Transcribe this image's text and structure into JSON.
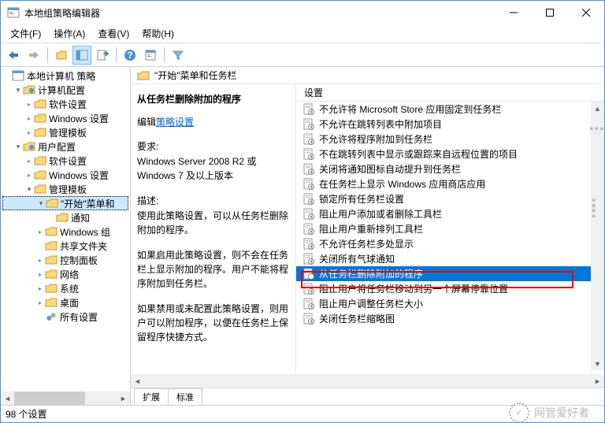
{
  "window": {
    "title": "本地组策略编辑器"
  },
  "menu": {
    "file": "文件(F)",
    "action": "操作(A)",
    "view": "查看(V)",
    "help": "帮助(H)"
  },
  "tree": {
    "root": "本地计算机 策略",
    "comp_conf": "计算机配置",
    "sw_settings1": "软件设置",
    "win_settings1": "Windows 设置",
    "admin_tpl1": "管理模板",
    "user_conf": "用户配置",
    "sw_settings2": "软件设置",
    "win_settings2": "Windows 设置",
    "admin_tpl2": "管理模板",
    "start_taskbar": "\"开始\"菜单和",
    "notify": "通知",
    "win_components": "Windows 组",
    "shared_folders": "共享文件夹",
    "control_panel": "控制面板",
    "network": "网络",
    "system": "系统",
    "desktop": "桌面",
    "all_settings": "所有设置"
  },
  "header": {
    "title": "\"开始\"菜单和任务栏"
  },
  "detail": {
    "title": "从任务栏删除附加的程序",
    "edit_prefix": "编辑",
    "edit_link": "策略设置",
    "req_label": "要求:",
    "req_text": "Windows Server 2008 R2 或 Windows 7 及以上版本",
    "desc_label": "描述:",
    "desc_text1": "使用此策略设置，可以从任务栏删除附加的程序。",
    "desc_text2": "如果启用此策略设置，则不会在任务栏上显示附加的程序。用户不能将程序附加到任务栏。",
    "desc_text3": "如果禁用或未配置此策略设置，则用户可以附加程序，以便在任务栏上保留程序快捷方式。"
  },
  "settings": {
    "header": "设置",
    "items": [
      "不允许将 Microsoft Store 应用固定到任务栏",
      "不允许在跳转列表中附加项目",
      "不允许将程序附加到任务栏",
      "不在跳转列表中显示或跟踪来自远程位置的项目",
      "关闭将通知图标自动提升到任务栏",
      "在任务栏上显示 Windows 应用商店应用",
      "锁定所有任务栏设置",
      "阻止用户添加或者删除工具栏",
      "阻止用户重新排列工具栏",
      "不允许任务栏多处显示",
      "关闭所有气球通知",
      "从任务栏删除附加的程序",
      "阻止用户将任务栏移动到另一个屏幕停靠位置",
      "阻止用户调整任务栏大小",
      "关闭任务栏缩略图"
    ],
    "selected_index": 11
  },
  "tabs": {
    "extended": "扩展",
    "standard": "标准"
  },
  "status": {
    "text": "98 个设置"
  },
  "watermark": {
    "text": "网管爱好者"
  }
}
